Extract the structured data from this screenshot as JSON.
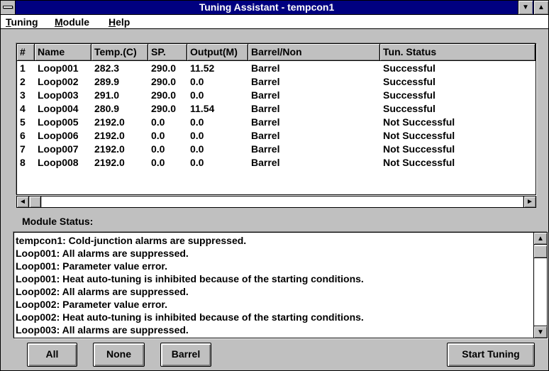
{
  "window": {
    "title": "Tuning Assistant - tempcon1"
  },
  "title_buttons": {
    "minimize": "▼",
    "maximize": "▲"
  },
  "menu": {
    "items": [
      "Tuning",
      "Module",
      "Help"
    ]
  },
  "table": {
    "columns": [
      "#",
      "Name",
      "Temp.(C)",
      "SP.",
      "Output(M)",
      "Barrel/Non",
      "Tun. Status"
    ],
    "rows": [
      [
        "1",
        "Loop001",
        "282.3",
        "290.0",
        "11.52",
        "Barrel",
        "Successful"
      ],
      [
        "2",
        "Loop002",
        "289.9",
        "290.0",
        "0.0",
        "Barrel",
        "Successful"
      ],
      [
        "3",
        "Loop003",
        "291.0",
        "290.0",
        "0.0",
        "Barrel",
        "Successful"
      ],
      [
        "4",
        "Loop004",
        "280.9",
        "290.0",
        "11.54",
        "Barrel",
        "Successful"
      ],
      [
        "5",
        "Loop005",
        "2192.0",
        "0.0",
        "0.0",
        "Barrel",
        "Not Successful"
      ],
      [
        "6",
        "Loop006",
        "2192.0",
        "0.0",
        "0.0",
        "Barrel",
        "Not Successful"
      ],
      [
        "7",
        "Loop007",
        "2192.0",
        "0.0",
        "0.0",
        "Barrel",
        "Not Successful"
      ],
      [
        "8",
        "Loop008",
        "2192.0",
        "0.0",
        "0.0",
        "Barrel",
        "Not Successful"
      ]
    ]
  },
  "scroll_arrows": {
    "left": "◄",
    "right": "►",
    "up": "▲",
    "down": "▼"
  },
  "module_status": {
    "label": "Module Status:",
    "lines": [
      "tempcon1: Cold-junction alarms are suppressed.",
      "Loop001: All alarms are suppressed.",
      "Loop001: Parameter value error.",
      "Loop001: Heat auto-tuning is inhibited because of the starting conditions.",
      "Loop002: All alarms are suppressed.",
      "Loop002: Parameter value error.",
      "Loop002: Heat auto-tuning is inhibited because of the starting conditions.",
      "Loop003: All alarms are suppressed."
    ]
  },
  "buttons": {
    "all": "All",
    "none": "None",
    "barrel": "Barrel",
    "start_tuning": "Start Tuning"
  },
  "colors": {
    "title_bar": "#000080",
    "face": "#c0c0c0",
    "window": "#ffffff"
  }
}
